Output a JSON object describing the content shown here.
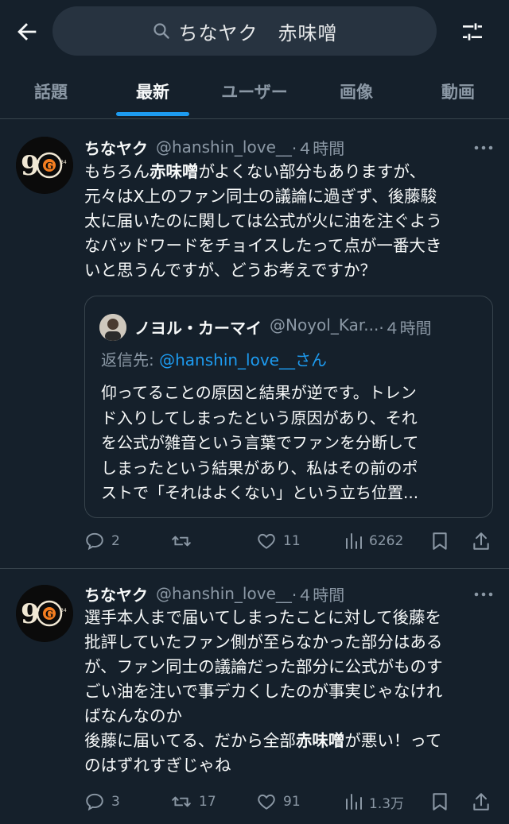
{
  "search": {
    "query": "ちなヤク　赤味噌"
  },
  "icons": {
    "back": "arrow-left-icon",
    "search": "search-icon",
    "filter": "sliders-icon",
    "more": "more-dots-icon",
    "reply": "reply-icon",
    "retweet": "retweet-icon",
    "like": "heart-icon",
    "views": "views-icon",
    "bookmark": "bookmark-icon",
    "share": "share-icon"
  },
  "colors": {
    "background": "#15202b",
    "accent": "#1d9bf0",
    "muted": "#8b98a5",
    "border": "#38444d"
  },
  "tabs": [
    {
      "label": "話題"
    },
    {
      "label": "最新",
      "active": true
    },
    {
      "label": "ユーザー"
    },
    {
      "label": "画像"
    },
    {
      "label": "動画"
    }
  ],
  "tweets": [
    {
      "name": "ちなヤク",
      "handle": "@hanshin_love__",
      "time": "·４時間",
      "text_parts": [
        {
          "text": "もちろん",
          "bold": false
        },
        {
          "text": "赤味噌",
          "bold": true
        },
        {
          "text": "がよくない部分もありますが、\n元々はX上のファン同士の議論に過ぎず、後藤駿\n太に届いたのに関しては公式が火に油を注ぐよう\nなバッドワードをチョイスしたって点が一番大き\nいと思うんですが、どうお考えですか？",
          "bold": false
        }
      ],
      "quote": {
        "name": "ノヨル・カーマイ",
        "handle": "@Noyol_Kar...",
        "time": "·４時間",
        "reply_prefix": "返信先: ",
        "reply_handle": "@hanshin_love__さん",
        "text": "仰ってることの原因と結果が逆です。トレン\nド入りしてしまったという原因があり、それ\nを公式が雑音という言葉でファンを分断して\nしまったという結果があり、私はその前のポ\nストで「それはよくない」という立ち位置..."
      },
      "replies": "2",
      "retweets": "",
      "likes": "11",
      "views": "6262"
    },
    {
      "name": "ちなヤク",
      "handle": "@hanshin_love__",
      "time": "·４時間",
      "text_parts": [
        {
          "text": "選手本人まで届いてしまったことに対して後藤を\n批評していたファン側が至らなかった部分はある\nが、ファン同士の議論だった部分に公式がものす\nごい油を注いで事デカくしたのが事実じゃなけれ\nばなんなのか\n後藤に届いてる、だから全部",
          "bold": false
        },
        {
          "text": "赤味噌",
          "bold": true
        },
        {
          "text": "が悪い！って\nのはずれすぎじゃね",
          "bold": false
        }
      ],
      "replies": "3",
      "retweets": "17",
      "likes": "91",
      "views": "1.3万"
    }
  ]
}
